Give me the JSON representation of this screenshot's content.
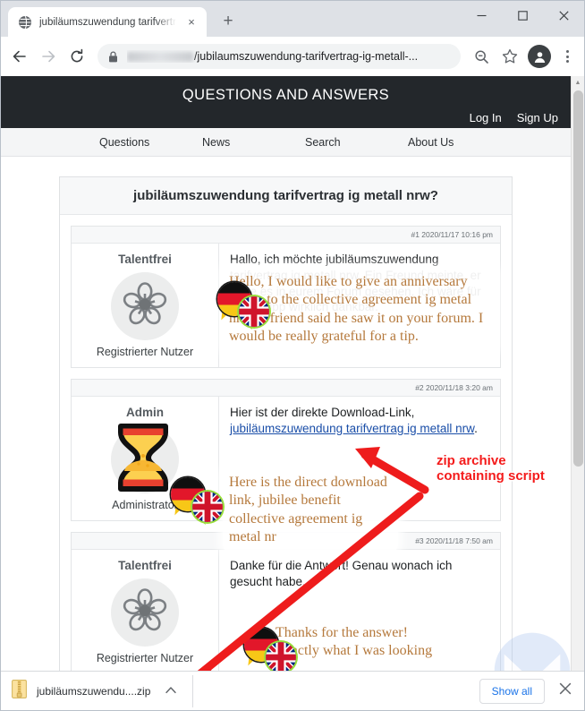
{
  "browser": {
    "tab": {
      "title": "jubiläumszuwendung tarifvertrag",
      "favicon": "globe-icon",
      "close": "×"
    },
    "newtab_label": "+",
    "window_controls": {
      "minimize": "—",
      "maximize": "▫",
      "close": "✕"
    },
    "toolbar": {
      "back": "←",
      "forward": "→",
      "reload": "⟳",
      "url_path": "/jubilaumszuwendung-tarifvertrag-ig-metall-...",
      "zoom_icon": "search-minus-icon",
      "bookmark_icon": "star-icon",
      "profile_icon": "profile-avatar-icon",
      "menu_icon": "three-dot-menu-icon"
    }
  },
  "site": {
    "title": "QUESTIONS AND ANSWERS",
    "auth": [
      {
        "label": "Log In"
      },
      {
        "label": "Sign Up"
      }
    ],
    "nav": [
      {
        "label": "Questions"
      },
      {
        "label": "News"
      },
      {
        "label": "Search"
      },
      {
        "label": "About Us"
      }
    ]
  },
  "thread": {
    "title": "jubiläumszuwendung tarifvertrag ig metall nrw?",
    "posts": [
      {
        "meta": "#1 2020/11/17 10:16 pm",
        "author": "Talentfrei",
        "role": "Registrierter Nutzer",
        "avatar": "flower-icon",
        "body_prefix": "Hallo, ich möchte jubiläumszuwendung tarifvertrag ig metall nrw. Ein Freund meinte, er habe es in eurem Forum gesehen. Ich wäre für einen Tipp wirklich dankbar.",
        "translation": "Hello, I would like to give an anniversary bonus to the collective agreement ig metal nrw. A friend said he saw it on your forum. I would be really grateful for a tip."
      },
      {
        "meta": "#2 2020/11/18 3:20 am",
        "author": "Admin",
        "role": "Administrator",
        "avatar": "hourglass-icon",
        "body_prefix": "Hier ist der direkte Download-Link,",
        "link_text": "jubiläumszuwendung tarifvertrag ig metall nrw",
        "body_suffix": ".",
        "translation": "Here is the direct download link, jubilee benefit collective agreement ig metal nr"
      },
      {
        "meta": "#3 2020/11/18 7:50 am",
        "author": "Talentfrei",
        "role": "Registrierter Nutzer",
        "avatar": "flower-icon",
        "body_prefix": "Danke für die Antwort! Genau wonach ich gesucht habe.",
        "translation": "Thanks for the answer! Exactly what I was looking for."
      }
    ]
  },
  "annotations": [
    {
      "line1": "zip archive",
      "line2": "containing script",
      "color": "#f41b1b"
    }
  ],
  "download_bar": {
    "file_name": "jubiläumszuwendu....zip",
    "file_icon": "zip-file-icon",
    "caret": "^",
    "show_all": "Show all",
    "close": "✕"
  },
  "colors": {
    "header_bg": "#23272b",
    "accent_link": "#1a4ea8",
    "annotation_red": "#f41b1b",
    "translation_brown": "#b5793c",
    "showall_blue": "#1a73e8"
  }
}
